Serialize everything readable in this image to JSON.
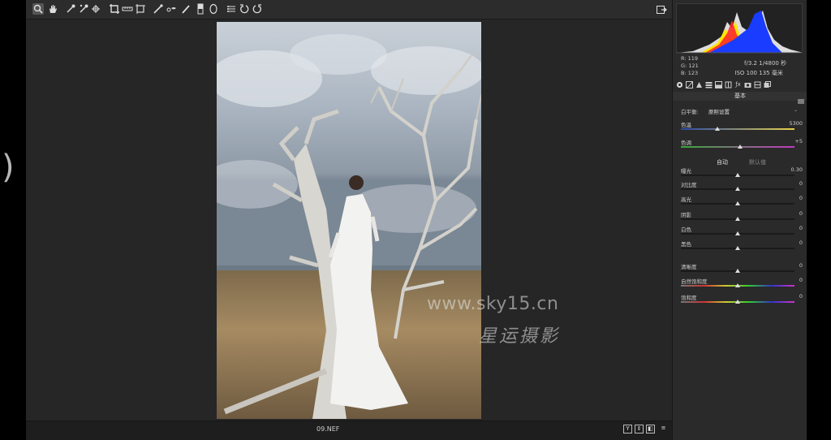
{
  "toolbar": {
    "tools": [
      "zoom-tool",
      "hand-tool",
      "white-balance-tool",
      "color-sampler-tool",
      "targeted-adjustment-tool",
      "crop-tool",
      "straighten-tool",
      "transform-tool",
      "spot-removal-tool",
      "red-eye-tool",
      "adjustment-brush",
      "graduated-filter",
      "radial-filter",
      "preferences",
      "rotate-ccw",
      "rotate-cw"
    ]
  },
  "image": {
    "filename": "09.NEF"
  },
  "watermark": {
    "url": "www.sky15.cn",
    "name": "星运摄影"
  },
  "histogram": {
    "r": "119",
    "g": "121",
    "b": "123",
    "r_label": "R:",
    "g_label": "G:",
    "b_label": "B:"
  },
  "exif": {
    "aperture": "f/3.2",
    "shutter": "1/4800 秒",
    "iso": "ISO 100",
    "focal": "135 毫米"
  },
  "panel": {
    "section_title": "基本",
    "white_balance_label": "白平衡:",
    "white_balance_value": "原照设置",
    "auto_label": "自动",
    "default_label": "默认值",
    "sliders": [
      {
        "label": "色温",
        "value": "5300",
        "pos": 0.32
      },
      {
        "label": "色调",
        "value": "+5",
        "pos": 0.52
      },
      {
        "label": "曝光",
        "value": "0.30",
        "pos": 0.5
      },
      {
        "label": "对比度",
        "value": "0",
        "pos": 0.5
      },
      {
        "label": "高光",
        "value": "0",
        "pos": 0.5
      },
      {
        "label": "阴影",
        "value": "0",
        "pos": 0.5
      },
      {
        "label": "白色",
        "value": "0",
        "pos": 0.5
      },
      {
        "label": "黑色",
        "value": "0",
        "pos": 0.5
      },
      {
        "label": "清晰度",
        "value": "0",
        "pos": 0.5
      },
      {
        "label": "自然饱和度",
        "value": "0",
        "pos": 0.5
      },
      {
        "label": "饱和度",
        "value": "0",
        "pos": 0.5
      }
    ]
  },
  "statusbar": {
    "buttons": [
      "Y",
      "⇕",
      "◧",
      "≡"
    ]
  },
  "colors": {
    "panel_bg": "#2a2a2a",
    "canvas_bg": "#262626",
    "accent": "#dddddd"
  }
}
